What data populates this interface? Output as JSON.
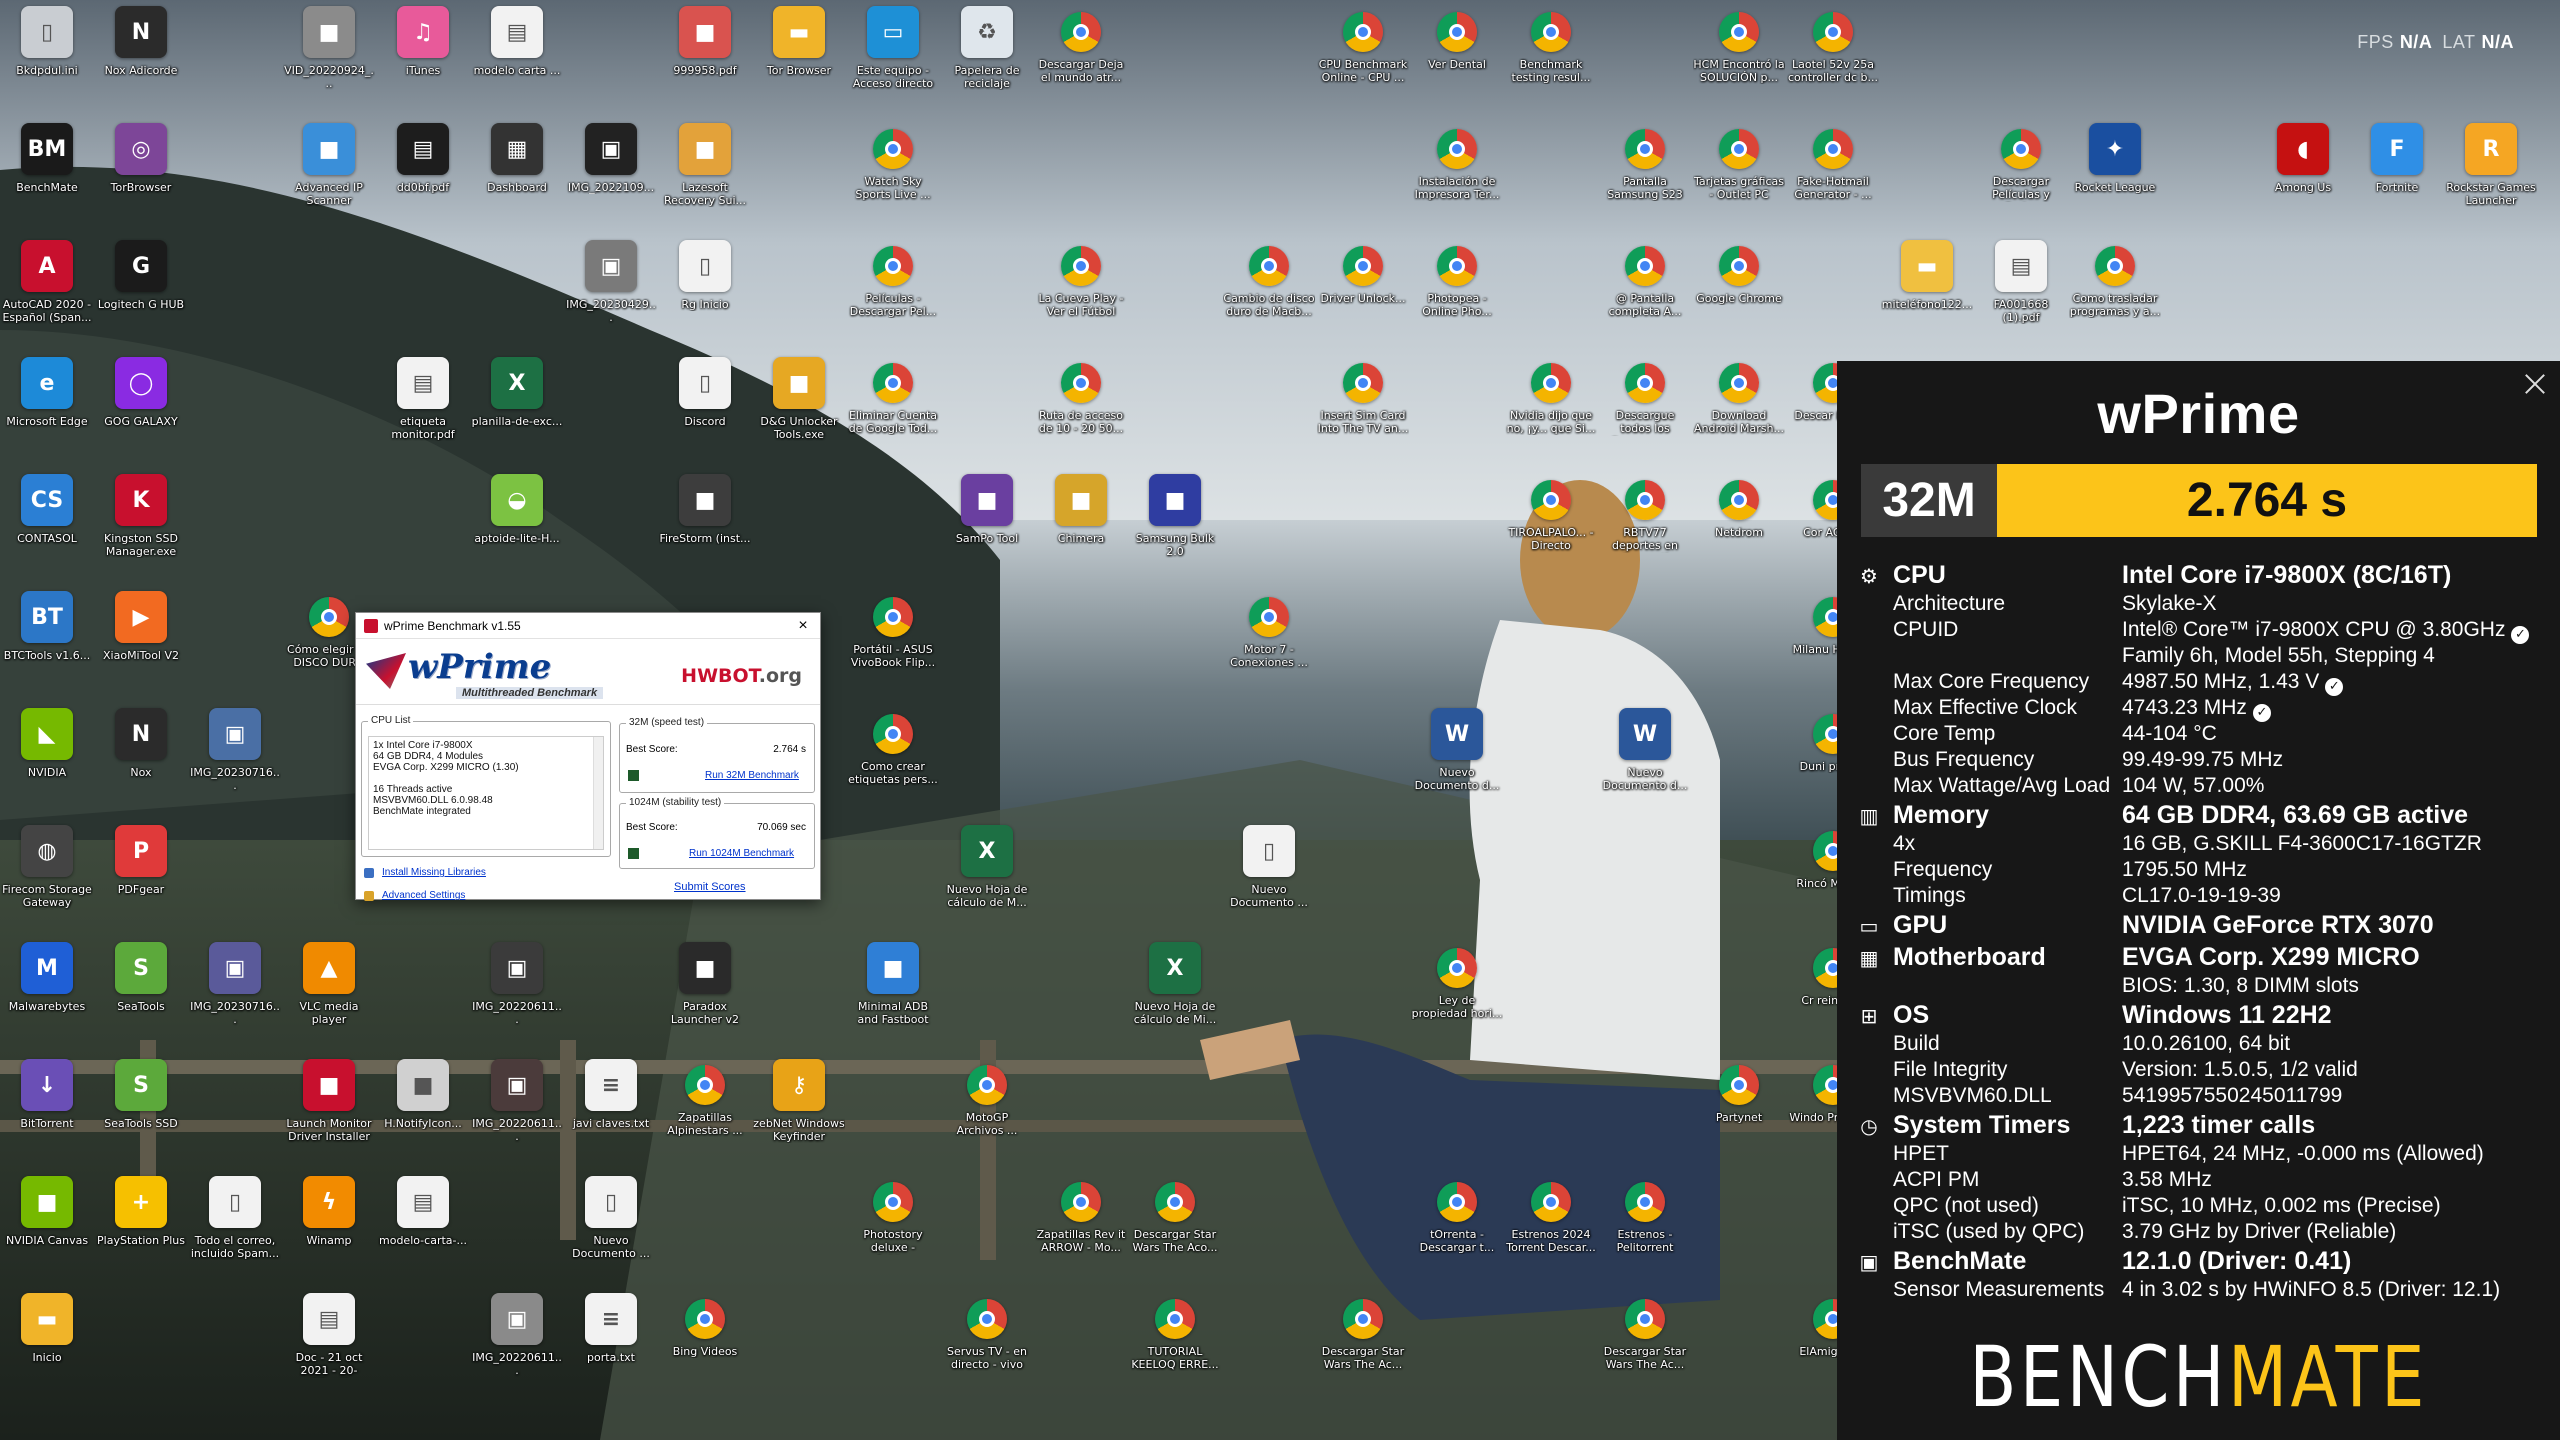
{
  "overlay": {
    "fps_label": "FPS",
    "fps_value": "N/A",
    "lat_label": "LAT",
    "lat_value": "N/A"
  },
  "desktop_icons": [
    {
      "label": "Bkdpdul.ini",
      "icon": "file-icon",
      "color": "#c9cdd2"
    },
    {
      "label": "Nox Adicorde",
      "icon": "nox-icon",
      "color": "#2b2b2b"
    },
    {
      "label": "VID_20220924_...",
      "icon": "video-file-icon",
      "color": "#8b8b8b"
    },
    {
      "label": "iTunes",
      "icon": "itunes-icon",
      "color": "#e85a9a"
    },
    {
      "label": "modelo carta ...",
      "icon": "pdf-icon",
      "color": "#f2f2f2"
    },
    {
      "label": "999958.pdf",
      "icon": "document-icon",
      "color": "#d9534f"
    },
    {
      "label": "Tor Browser",
      "icon": "folder-icon",
      "color": "#f0b429"
    },
    {
      "label": "Este equipo - Acceso directo",
      "icon": "computer-icon",
      "color": "#1e90d6"
    },
    {
      "label": "Papelera de reciclaje",
      "icon": "recycle-bin-icon",
      "color": "#dfe6ec"
    },
    {
      "label": "Descargar Deja el mundo atr...",
      "icon": "chrome-icon",
      "color": "#ffffff"
    },
    {
      "label": "CPU Benchmark Online - CPU ...",
      "icon": "chrome-icon",
      "color": "#ffffff"
    },
    {
      "label": "Ver Dental",
      "icon": "chrome-icon",
      "color": "#ffffff"
    },
    {
      "label": "Benchmark testing resul...",
      "icon": "chrome-icon",
      "color": "#ffffff"
    },
    {
      "label": "HCM Encontró la SOLUCIÓN p...",
      "icon": "chrome-icon",
      "color": "#ffffff"
    },
    {
      "label": "Laotel 52v 25a controller dc b...",
      "icon": "chrome-icon",
      "color": "#ffffff"
    },
    {
      "label": "BenchMate",
      "icon": "benchmate-icon",
      "color": "#1a1a1a"
    },
    {
      "label": "TorBrowser",
      "icon": "tor-icon",
      "color": "#7d4698"
    },
    {
      "label": "Advanced IP Scanner",
      "icon": "ip-scanner-icon",
      "color": "#3a8fd9"
    },
    {
      "label": "dd0bf.pdf",
      "icon": "pdf-icon",
      "color": "#1d1d1d"
    },
    {
      "label": "Dashboard",
      "icon": "dashboard-icon",
      "color": "#333333"
    },
    {
      "label": "IMG_2022109...",
      "icon": "image-icon",
      "color": "#222222"
    },
    {
      "label": "Lazesoft Recovery Sui...",
      "icon": "lazesoft-icon",
      "color": "#e3a23a"
    },
    {
      "label": "Watch Sky Sports Live ...",
      "icon": "chrome-icon",
      "color": "#ffffff"
    },
    {
      "label": "Instalación de Impresora Ter...",
      "icon": "chrome-icon",
      "color": "#ffffff"
    },
    {
      "label": "Pantalla Samsung S23",
      "icon": "chrome-icon",
      "color": "#ffffff"
    },
    {
      "label": "Tarjetas gráficas - Outlet PC",
      "icon": "chrome-icon",
      "color": "#ffffff"
    },
    {
      "label": "Fake-Hotmail Generator - ...",
      "icon": "chrome-icon",
      "color": "#ffffff"
    },
    {
      "label": "Descargar Películas y Series",
      "icon": "chrome-icon",
      "color": "#ffffff"
    },
    {
      "label": "Rocket League",
      "icon": "rocket-league-icon",
      "color": "#1a4fa0"
    },
    {
      "label": "Among Us",
      "icon": "among-us-icon",
      "color": "#c51111"
    },
    {
      "label": "Fortnite",
      "icon": "fortnite-icon",
      "color": "#2f8fe6"
    },
    {
      "label": "Rockstar Games Launcher",
      "icon": "rockstar-icon",
      "color": "#f5a623"
    },
    {
      "label": "AutoCAD 2020 - Español (Span...",
      "icon": "autocad-icon",
      "color": "#c8102e"
    },
    {
      "label": "Logitech G HUB",
      "icon": "logitech-icon",
      "color": "#1b1b1b"
    },
    {
      "label": "IMG_20230429...",
      "icon": "image-icon",
      "color": "#7a7a7a"
    },
    {
      "label": "Rg Inicio",
      "icon": "file-icon",
      "color": "#f2f2f2"
    },
    {
      "label": "Películas - Descargar Pel...",
      "icon": "chrome-icon",
      "color": "#ffffff"
    },
    {
      "label": "La Cueva Play - Ver el Fútbol",
      "icon": "chrome-icon",
      "color": "#ffffff"
    },
    {
      "label": "Cambio de disco duro de Macb...",
      "icon": "chrome-icon",
      "color": "#ffffff"
    },
    {
      "label": "Driver Unlock...",
      "icon": "chrome-icon",
      "color": "#ffffff"
    },
    {
      "label": "Photopea - Online Pho...",
      "icon": "chrome-icon",
      "color": "#ffffff"
    },
    {
      "label": "@ Pantalla completa A...",
      "icon": "chrome-icon",
      "color": "#ffffff"
    },
    {
      "label": "Google Chrome",
      "icon": "chrome-icon",
      "color": "#ffffff"
    },
    {
      "label": "miteléfono122...",
      "icon": "folder-icon",
      "color": "#f0c040"
    },
    {
      "label": "FA001668 (1).pdf",
      "icon": "pdf-icon",
      "color": "#f2f2f2"
    },
    {
      "label": "Como trasladar programas y a...",
      "icon": "chrome-icon",
      "color": "#ffffff"
    },
    {
      "label": "Microsoft Edge",
      "icon": "edge-icon",
      "color": "#1d8ad8"
    },
    {
      "label": "GOG GALAXY",
      "icon": "gog-icon",
      "color": "#8a2be2"
    },
    {
      "label": "etiqueta monitor.pdf",
      "icon": "pdf-icon",
      "color": "#f2f2f2"
    },
    {
      "label": "planilla-de-exc...",
      "icon": "excel-icon",
      "color": "#1d7044"
    },
    {
      "label": "Discord",
      "icon": "file-icon",
      "color": "#f2f2f2"
    },
    {
      "label": "D&G Unlocker Tools.exe",
      "icon": "dg-unlocker-icon",
      "color": "#e6a823"
    },
    {
      "label": "Eliminar Cuenta de Google Tod...",
      "icon": "chrome-icon",
      "color": "#ffffff"
    },
    {
      "label": "Ruta de acceso de 10 - 20 50...",
      "icon": "chrome-icon",
      "color": "#ffffff"
    },
    {
      "label": "Insert Sim Card Into The TV an...",
      "icon": "chrome-icon",
      "color": "#ffffff"
    },
    {
      "label": "Nvidia dijo que no, ¡y... que Si...",
      "icon": "chrome-icon",
      "color": "#ffffff"
    },
    {
      "label": "Descargue todos los firmwares ...",
      "icon": "chrome-icon",
      "color": "#ffffff"
    },
    {
      "label": "Download Android Marsh...",
      "icon": "chrome-icon",
      "color": "#ffffff"
    },
    {
      "label": "Descar Líneas",
      "icon": "chrome-icon",
      "color": "#ffffff"
    },
    {
      "label": "CONTASOL",
      "icon": "contasol-icon",
      "color": "#2b7fd4"
    },
    {
      "label": "Kingston SSD Manager.exe",
      "icon": "kingston-icon",
      "color": "#c8102e"
    },
    {
      "label": "aptoide-lite-H...",
      "icon": "android-icon",
      "color": "#7cc242"
    },
    {
      "label": "FireStorm (inst...",
      "icon": "installer-icon",
      "color": "#3d3d3d"
    },
    {
      "label": "SamPo Tool",
      "icon": "sampo-icon",
      "color": "#6a3fa0"
    },
    {
      "label": "Chimera",
      "icon": "chimera-icon",
      "color": "#d6a52a"
    },
    {
      "label": "Samsung Bulk 2.0",
      "icon": "samsung-icon",
      "color": "#2f3da1"
    },
    {
      "label": "TIROALPALO... - Directo",
      "icon": "chrome-icon",
      "color": "#ffffff"
    },
    {
      "label": "RBTV77 deportes en vivo gratis",
      "icon": "chrome-icon",
      "color": "#ffffff"
    },
    {
      "label": "Netdrom",
      "icon": "chrome-icon",
      "color": "#ffffff"
    },
    {
      "label": "Cor ACTUA",
      "icon": "chrome-icon",
      "color": "#ffffff"
    },
    {
      "label": "BTCTools v1.6...",
      "icon": "btc-tools-icon",
      "color": "#2c77c7"
    },
    {
      "label": "XiaoMiTool V2",
      "icon": "xiaomi-icon",
      "color": "#f26a21"
    },
    {
      "label": "Cómo elegir un DISCO DURO",
      "icon": "chrome-icon",
      "color": "#ffffff"
    },
    {
      "label": "Portátil - ASUS VivoBook Flip...",
      "icon": "chrome-icon",
      "color": "#ffffff"
    },
    {
      "label": "Motor 7 - Conexiones ...",
      "icon": "chrome-icon",
      "color": "#ffffff"
    },
    {
      "label": "Milanu HONDA",
      "icon": "chrome-icon",
      "color": "#ffffff"
    },
    {
      "label": "NVIDIA",
      "icon": "nvidia-icon",
      "color": "#76b900"
    },
    {
      "label": "Nox",
      "icon": "nox-icon",
      "color": "#2b2b2b"
    },
    {
      "label": "IMG_20230716...",
      "icon": "image-icon",
      "color": "#4a6fa5"
    },
    {
      "label": "Como crear etiquetas pers...",
      "icon": "chrome-icon",
      "color": "#ffffff"
    },
    {
      "label": "Nuevo Documento d...",
      "icon": "word-icon",
      "color": "#2b579a"
    },
    {
      "label": "Nuevo Documento d...",
      "icon": "word-icon",
      "color": "#2b579a"
    },
    {
      "label": "Duni profecl",
      "icon": "chrome-icon",
      "color": "#ffffff"
    },
    {
      "label": "Firecom Storage Gateway Assistn...",
      "icon": "storage-icon",
      "color": "#444444"
    },
    {
      "label": "PDFgear",
      "icon": "pdfgear-icon",
      "color": "#e03a3a"
    },
    {
      "label": "Nuevo Hoja de cálculo de M...",
      "icon": "excel-icon",
      "color": "#1d7044"
    },
    {
      "label": "Nuevo Documento ...",
      "icon": "file-icon",
      "color": "#f2f2f2"
    },
    {
      "label": "Rincó Motor -",
      "icon": "chrome-icon",
      "color": "#ffffff"
    },
    {
      "label": "Malwarebytes",
      "icon": "malwarebytes-icon",
      "color": "#1f5fd6"
    },
    {
      "label": "SeaTools",
      "icon": "seatools-icon",
      "color": "#5ca93b"
    },
    {
      "label": "IMG_20230716...",
      "icon": "image-icon",
      "color": "#5a5a9a"
    },
    {
      "label": "VLC media player",
      "icon": "vlc-icon",
      "color": "#f08a00"
    },
    {
      "label": "IMG_20220611...",
      "icon": "image-icon",
      "color": "#3b3b3b"
    },
    {
      "label": "Paradox Launcher v2",
      "icon": "paradox-icon",
      "color": "#2a2a2a"
    },
    {
      "label": "Minimal ADB and Fastboot",
      "icon": "adb-icon",
      "color": "#2f7fd6"
    },
    {
      "label": "Nuevo Hoja de cálculo de Mi...",
      "icon": "excel-icon",
      "color": "#1d7044"
    },
    {
      "label": "Ley de propiedad hori...",
      "icon": "chrome-icon",
      "color": "#ffffff"
    },
    {
      "label": "Cr reinstala",
      "icon": "chrome-icon",
      "color": "#ffffff"
    },
    {
      "label": "BitTorrent",
      "icon": "bittorrent-icon",
      "color": "#6a4fb6"
    },
    {
      "label": "SeaTools SSD",
      "icon": "seatools-icon",
      "color": "#5ca93b"
    },
    {
      "label": "Launch Monitor Driver Installer",
      "icon": "monitor-installer-icon",
      "color": "#c8102e"
    },
    {
      "label": "H.NotifyIcon...",
      "icon": "settings-file-icon",
      "color": "#d0d0d0"
    },
    {
      "label": "IMG_20220611...",
      "icon": "image-icon",
      "color": "#4b3b3b"
    },
    {
      "label": "javi claves.txt",
      "icon": "text-file-icon",
      "color": "#f2f2f2"
    },
    {
      "label": "Zapatillas Alpinestars ...",
      "icon": "chrome-icon",
      "color": "#ffffff"
    },
    {
      "label": "zebNet Windows Keyfinder",
      "icon": "key-icon",
      "color": "#e8a317"
    },
    {
      "label": "MotoGP Archivos ...",
      "icon": "chrome-icon",
      "color": "#ffffff"
    },
    {
      "label": "Partynet",
      "icon": "chrome-icon",
      "color": "#ffffff"
    },
    {
      "label": "Windo Professio",
      "icon": "chrome-icon",
      "color": "#ffffff"
    },
    {
      "label": "NVIDIA Canvas",
      "icon": "nvidia-canvas-icon",
      "color": "#76b900"
    },
    {
      "label": "PlayStation Plus",
      "icon": "playstation-icon",
      "color": "#f6c000"
    },
    {
      "label": "Todo el correo, incluido Spam...",
      "icon": "file-icon",
      "color": "#f2f2f2"
    },
    {
      "label": "Winamp",
      "icon": "winamp-icon",
      "color": "#f28b00"
    },
    {
      "label": "modelo-carta-...",
      "icon": "pdf-icon",
      "color": "#f2f2f2"
    },
    {
      "label": "Nuevo Documento ...",
      "icon": "file-icon",
      "color": "#f2f2f2"
    },
    {
      "label": "Photostory deluxe - rápido...",
      "icon": "chrome-icon",
      "color": "#ffffff"
    },
    {
      "label": "Zapatillas Rev it ARROW - Mo...",
      "icon": "chrome-icon",
      "color": "#ffffff"
    },
    {
      "label": "Descargar Star Wars The Aco...",
      "icon": "chrome-icon",
      "color": "#ffffff"
    },
    {
      "label": "tOrrenta - Descargar t...",
      "icon": "chrome-icon",
      "color": "#ffffff"
    },
    {
      "label": "Estrenos 2024 Torrent Descar...",
      "icon": "chrome-icon",
      "color": "#ffffff"
    },
    {
      "label": "Estrenos - Pelitorrent",
      "icon": "chrome-icon",
      "color": "#ffffff"
    },
    {
      "label": "Inicio",
      "icon": "folder-icon",
      "color": "#f0b429"
    },
    {
      "label": "Doc - 21 oct 2021 - 20-27.pdf",
      "icon": "pdf-icon",
      "color": "#f2f2f2"
    },
    {
      "label": "IMG_20220611...",
      "icon": "image-icon",
      "color": "#8a8a8a"
    },
    {
      "label": "porta.txt",
      "icon": "text-file-icon",
      "color": "#f2f2f2"
    },
    {
      "label": "Bing Videos",
      "icon": "chrome-icon",
      "color": "#ffffff"
    },
    {
      "label": "Servus TV - en directo - vivo",
      "icon": "chrome-icon",
      "color": "#ffffff"
    },
    {
      "label": "TUTORIAL KEELOQ ERRE...",
      "icon": "chrome-icon",
      "color": "#ffffff"
    },
    {
      "label": "Descargar Star Wars The Ac...",
      "icon": "chrome-icon",
      "color": "#ffffff"
    },
    {
      "label": "Descargar Star Wars The Ac...",
      "icon": "chrome-icon",
      "color": "#ffffff"
    },
    {
      "label": "ElAmigos sit",
      "icon": "chrome-icon",
      "color": "#ffffff"
    }
  ],
  "wprime_window": {
    "title": "wPrime Benchmark v1.55",
    "logo_text": "wPrime",
    "logo_sub": "Multithreaded Benchmark",
    "hwbot_a": "HWBOT",
    "hwbot_b": ".org",
    "cpu_list_title": "CPU List",
    "cpu_list_lines": [
      "1x Intel Core i7-9800X",
      "64 GB DDR4, 4 Modules",
      "EVGA Corp. X299 MICRO (1.30)",
      "",
      "16 Threads active",
      "MSVBVM60.DLL 6.0.98.48",
      "BenchMate integrated"
    ],
    "bench32_title": "32M (speed test)",
    "bench32_best_label": "Best Score:",
    "bench32_best_value": "2.764 s",
    "bench32_run": "Run 32M Benchmark",
    "bench1024_title": "1024M (stability test)",
    "bench1024_best_label": "Best Score:",
    "bench1024_best_value": "70.069 sec",
    "bench1024_run": "Run 1024M Benchmark",
    "install_libraries": "Install Missing Libraries",
    "advanced_settings": "Advanced Settings",
    "submit_scores": "Submit Scores",
    "close": "×"
  },
  "benchmate": {
    "title": "wPrime",
    "score_label": "32M",
    "score_value": "2.764 s",
    "accent": "#fcc419",
    "rows": [
      {
        "type": "sec",
        "icon": "cpu-icon",
        "k": "CPU",
        "v": "Intel Core i7-9800X (8C/16T)"
      },
      {
        "type": "sub",
        "k": "Architecture",
        "v": "Skylake-X"
      },
      {
        "type": "sub",
        "k": "CPUID",
        "v": "Intel® Core™ i7-9800X CPU @ 3.80GHz",
        "check": true
      },
      {
        "type": "sub",
        "k": "",
        "v": "Family 6h, Model 55h, Stepping 4"
      },
      {
        "type": "sub",
        "k": "Max Core Frequency",
        "v": "4987.50 MHz, 1.43 V",
        "check": true
      },
      {
        "type": "sub",
        "k": "Max Effective Clock",
        "v": "4743.23 MHz",
        "check": true
      },
      {
        "type": "sub",
        "k": "Core Temp",
        "v": "44-104 °C"
      },
      {
        "type": "sub",
        "k": "Bus Frequency",
        "v": "99.49-99.75 MHz"
      },
      {
        "type": "sub",
        "k": "Max Wattage/Avg Load",
        "v": "104 W, 57.00%"
      },
      {
        "type": "sec",
        "icon": "memory-icon",
        "k": "Memory",
        "v": "64 GB DDR4, 63.69 GB active"
      },
      {
        "type": "sub",
        "k": "4x",
        "v": "16 GB, G.SKILL F4-3600C17-16GTZR"
      },
      {
        "type": "sub",
        "k": "Frequency",
        "v": "1795.50 MHz"
      },
      {
        "type": "sub",
        "k": "Timings",
        "v": "CL17.0-19-19-39"
      },
      {
        "type": "sec",
        "icon": "gpu-icon",
        "k": "GPU",
        "v": "NVIDIA GeForce RTX 3070"
      },
      {
        "type": "sec",
        "icon": "motherboard-icon",
        "k": "Motherboard",
        "v": "EVGA Corp. X299 MICRO"
      },
      {
        "type": "sub",
        "k": "",
        "v": "BIOS: 1.30, 8 DIMM slots"
      },
      {
        "type": "sec",
        "icon": "windows-icon",
        "k": "OS",
        "v": "Windows 11 22H2"
      },
      {
        "type": "sub",
        "k": "Build",
        "v": "10.0.26100, 64 bit"
      },
      {
        "type": "sub",
        "k": "File Integrity",
        "v": "Version: 1.5.0.5, 1/2 valid"
      },
      {
        "type": "sub",
        "k": "MSVBVM60.DLL",
        "v": "5419957550245011799"
      },
      {
        "type": "sec",
        "icon": "timer-icon",
        "k": "System Timers",
        "v": "1,223 timer calls"
      },
      {
        "type": "sub",
        "k": "HPET",
        "v": "HPET64, 24 MHz, -0.000 ms (Allowed)"
      },
      {
        "type": "sub",
        "k": "ACPI PM",
        "v": "3.58 MHz"
      },
      {
        "type": "sub",
        "k": "QPC (not used)",
        "v": "iTSC, 10 MHz, 0.002 ms (Precise)"
      },
      {
        "type": "sub",
        "k": "iTSC (used by QPC)",
        "v": "3.79 GHz by Driver (Reliable)"
      },
      {
        "type": "sec",
        "icon": "benchmate-icon",
        "k": "BenchMate",
        "v": "12.1.0 (Driver: 0.41)"
      },
      {
        "type": "sub",
        "k": "Sensor Measurements",
        "v": "4 in 3.02 s by HWiNFO 8.5 (Driver: 12.1)"
      }
    ],
    "brand_a": "BENCH",
    "brand_b": "MATE"
  }
}
